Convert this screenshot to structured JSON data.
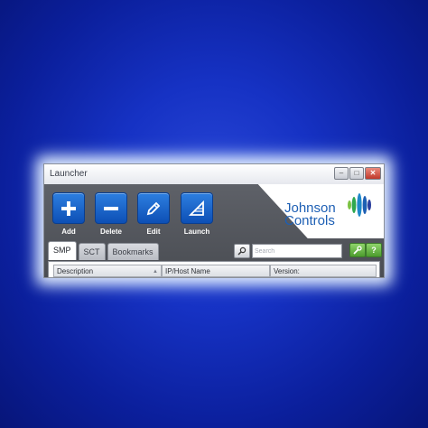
{
  "window": {
    "title": "Launcher",
    "controls": {
      "minimize": "–",
      "maximize": "□",
      "close": "✕"
    }
  },
  "brand": {
    "line1": "Johnson",
    "line2": "Controls",
    "color": "#1d5fb4"
  },
  "toolbar": {
    "buttons": [
      {
        "label": "Add",
        "icon": "plus-icon"
      },
      {
        "label": "Delete",
        "icon": "minus-icon"
      },
      {
        "label": "Edit",
        "icon": "pencil-icon"
      },
      {
        "label": "Launch",
        "icon": "launch-icon"
      }
    ]
  },
  "tabs": [
    {
      "label": "SMP",
      "active": true
    },
    {
      "label": "SCT",
      "active": false
    },
    {
      "label": "Bookmarks",
      "active": false
    }
  ],
  "search": {
    "placeholder": "Search"
  },
  "actions": {
    "tools_icon": "wrench-icon",
    "help_label": "?"
  },
  "table": {
    "columns": [
      "Description",
      "IP/Host Name",
      "Version:"
    ]
  }
}
